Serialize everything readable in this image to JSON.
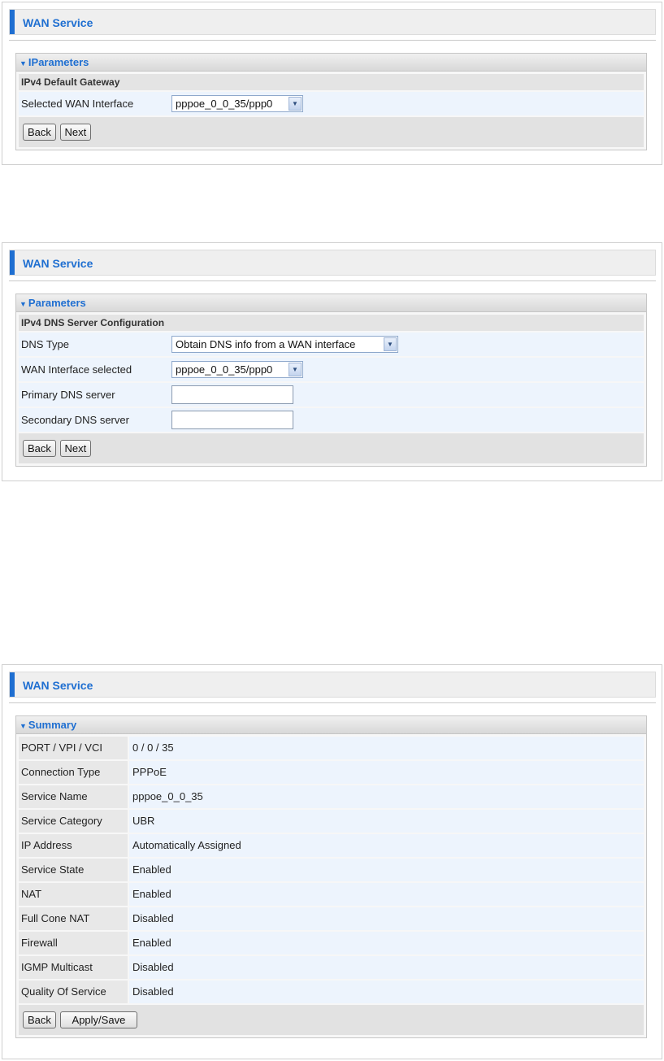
{
  "screen1": {
    "header_title": "WAN Service",
    "panel_title": "IParameters",
    "subhead": "IPv4 Default Gateway",
    "field_label": "Selected WAN Interface",
    "field_value": "pppoe_0_0_35/ppp0",
    "back_label": "Back",
    "next_label": "Next"
  },
  "screen2": {
    "header_title": "WAN Service",
    "panel_title": "Parameters",
    "subhead": "IPv4 DNS Server Configuration",
    "dns_type_label": "DNS Type",
    "dns_type_value": "Obtain DNS info from a WAN interface",
    "wan_if_label": "WAN Interface selected",
    "wan_if_value": "pppoe_0_0_35/ppp0",
    "primary_label": "Primary DNS server",
    "primary_value": "",
    "secondary_label": "Secondary DNS server",
    "secondary_value": "",
    "back_label": "Back",
    "next_label": "Next"
  },
  "screen3": {
    "header_title": "WAN Service",
    "panel_title": "Summary",
    "rows": [
      {
        "label": "PORT / VPI / VCI",
        "value": "0 / 0 / 35"
      },
      {
        "label": "Connection Type",
        "value": "PPPoE"
      },
      {
        "label": "Service Name",
        "value": "pppoe_0_0_35"
      },
      {
        "label": "Service Category",
        "value": "UBR"
      },
      {
        "label": "IP Address",
        "value": "Automatically Assigned"
      },
      {
        "label": "Service State",
        "value": "Enabled"
      },
      {
        "label": "NAT",
        "value": "Enabled"
      },
      {
        "label": "Full Cone NAT",
        "value": "Disabled"
      },
      {
        "label": "Firewall",
        "value": "Enabled"
      },
      {
        "label": "IGMP Multicast",
        "value": "Disabled"
      },
      {
        "label": "Quality Of Service",
        "value": "Disabled"
      }
    ],
    "back_label": "Back",
    "apply_label": "Apply/Save"
  },
  "colors": {
    "accent": "#1f6fd1",
    "row_bg": "#edf4fd",
    "label_bg": "#e8e8e8",
    "button_bar": "#e2e2e2"
  },
  "icons": {
    "panel_toggle": "triangle-down-icon",
    "select_arrow": "chevron-down-icon"
  }
}
